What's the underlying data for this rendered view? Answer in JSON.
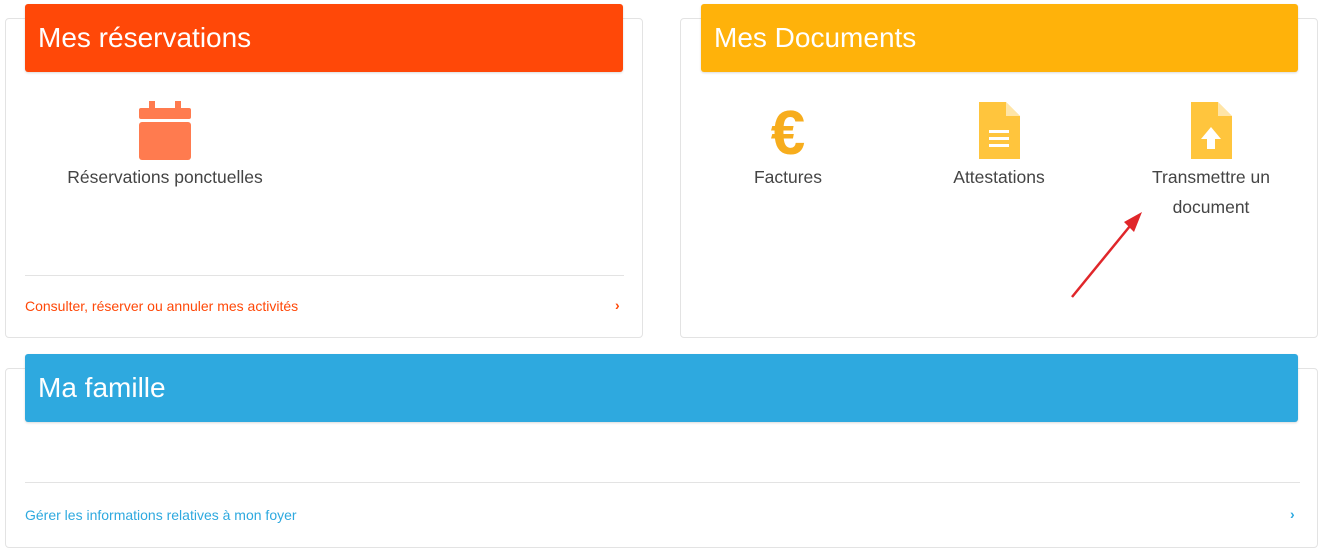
{
  "colors": {
    "reservations": "#ff4808",
    "documents": "#ffb20a",
    "famille": "#2ea9df",
    "calendar_icon": "#ff7b4f",
    "doc_icon": "#ffc53d",
    "euro_icon": "#f7ad1d",
    "annotation_arrow": "#e0262a"
  },
  "reservations": {
    "title": "Mes réservations",
    "items": [
      {
        "label": "Réservations ponctuelles",
        "icon": "calendar-icon"
      }
    ],
    "footer_link": "Consulter, réserver ou annuler mes activités",
    "footer_chevron": "›"
  },
  "documents": {
    "title": "Mes Documents",
    "items": [
      {
        "label": "Factures",
        "icon": "euro-icon"
      },
      {
        "label": "Attestations",
        "icon": "document-text-icon"
      },
      {
        "label": "Transmettre un",
        "label_line2": "document",
        "icon": "document-upload-icon"
      }
    ]
  },
  "famille": {
    "title": "Ma famille",
    "footer_link": "Gérer les informations relatives à mon foyer",
    "footer_chevron": "›"
  }
}
